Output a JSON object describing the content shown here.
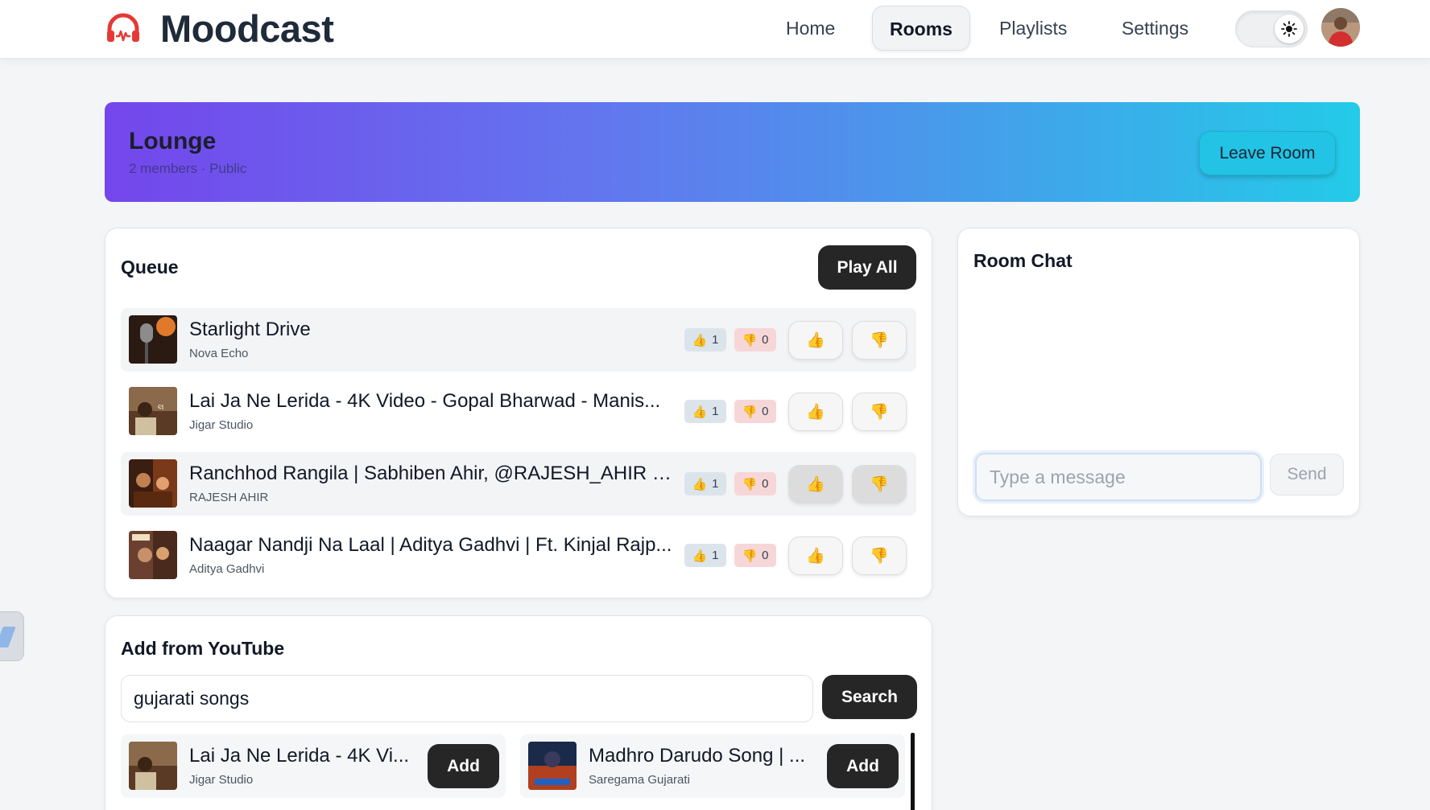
{
  "app": {
    "name": "Moodcast",
    "accent": "#e53935"
  },
  "nav": {
    "items": [
      {
        "label": "Home",
        "active": false
      },
      {
        "label": "Rooms",
        "active": true
      },
      {
        "label": "Playlists",
        "active": false
      },
      {
        "label": "Settings",
        "active": false
      }
    ],
    "theme_icon": "sun-icon"
  },
  "room": {
    "name": "Lounge",
    "meta": "2 members · Public",
    "leave_label": "Leave Room"
  },
  "queue": {
    "title": "Queue",
    "play_all_label": "Play All",
    "items": [
      {
        "title": "Starlight Drive",
        "artist": "Nova Echo",
        "likes": "1",
        "dislikes": "0"
      },
      {
        "title": "Lai Ja Ne Lerida - 4K Video - Gopal Bharwad - Manis...",
        "artist": "Jigar Studio",
        "likes": "1",
        "dislikes": "0"
      },
      {
        "title": "Ranchhod Rangila | Sabhiben Ahir, @RAJESH_AHIR | ...",
        "artist": "RAJESH AHIR",
        "likes": "1",
        "dislikes": "0"
      },
      {
        "title": "Naagar Nandji Na Laal | Aditya Gadhvi | Ft. Kinjal Rajp...",
        "artist": "Aditya Gadhvi",
        "likes": "1",
        "dislikes": "0"
      }
    ]
  },
  "chat": {
    "title": "Room Chat",
    "placeholder": "Type a message",
    "send_label": "Send"
  },
  "youtube": {
    "title": "Add from YouTube",
    "query": "gujarati songs",
    "search_label": "Search",
    "results": [
      {
        "title": "Lai Ja Ne Lerida - 4K Vi...",
        "channel": "Jigar Studio",
        "add_label": "Add"
      },
      {
        "title": "Madhro Darudo Song | ...",
        "channel": "Saregama Gujarati",
        "add_label": "Add"
      }
    ]
  }
}
